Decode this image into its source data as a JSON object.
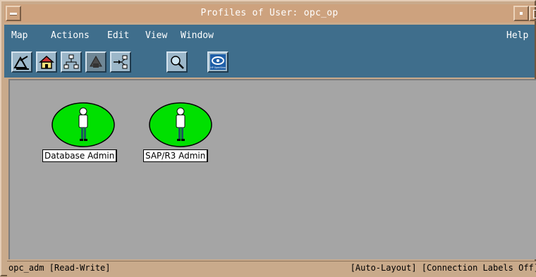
{
  "window": {
    "title": "Profiles of User: opc_op"
  },
  "menubar": {
    "items": [
      "Map",
      "Actions",
      "Edit",
      "View",
      "Window"
    ],
    "help": "Help"
  },
  "toolbar": {
    "buttons": [
      "home-submap-icon",
      "root-home-icon",
      "hierarchy-icon",
      "parent-map-icon",
      "navigate-arrow-icon",
      "search-icon",
      "hp-openview-icon"
    ],
    "logo_text": "HP OpenView"
  },
  "map": {
    "symbols": [
      {
        "label": "Database Admin",
        "color": "#00e000"
      },
      {
        "label": "SAP/R3 Admin",
        "color": "#00e000"
      }
    ]
  },
  "status": {
    "left": "opc_adm [Read-Write]",
    "right": "[Auto-Layout] [Connection Labels Off]"
  },
  "colors": {
    "frame": "#c9aa8b",
    "menubar": "#3f6e8c",
    "canvas": "#a5a5a5"
  }
}
